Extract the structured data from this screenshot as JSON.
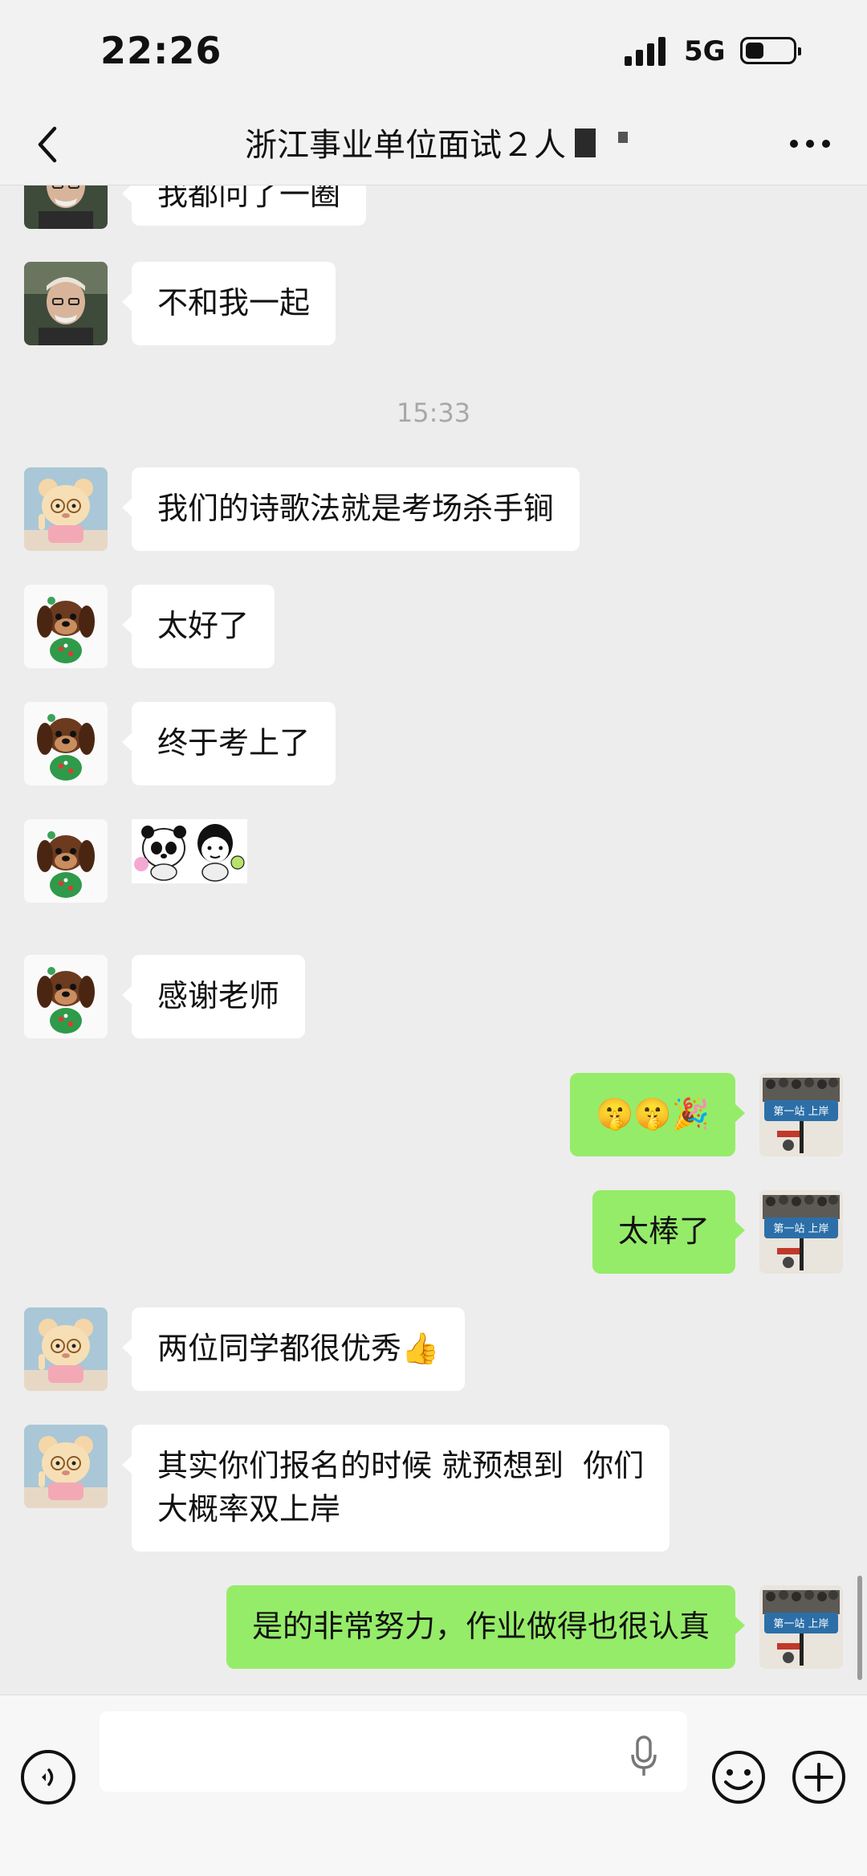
{
  "status_bar": {
    "time": "22:26",
    "network": "5G"
  },
  "header": {
    "title": "浙江事业单位面试２人"
  },
  "chat": {
    "partial_top_message": "我都问了一圈",
    "timestamp": "15:33",
    "messages": [
      {
        "text": "不和我一起"
      },
      {
        "text": "我们的诗歌法就是考场杀手锏"
      },
      {
        "text": "太好了"
      },
      {
        "text": "终于考上了"
      },
      {
        "text": "感谢老师"
      },
      {
        "text": "🤫🤫🎉"
      },
      {
        "text": "太棒了"
      },
      {
        "text": "两位同学都很优秀👍"
      },
      {
        "line1": "其实你们报名的时候 就预想到  你们",
        "line2": "大概率双上岸"
      },
      {
        "text": "是的非常努力，作业做得也很认真"
      }
    ],
    "avatar_labels": {
      "sender_sign": "第一站 上岸"
    }
  },
  "colors": {
    "background": "#ededed",
    "self_bubble": "#95ec69",
    "other_bubble": "#ffffff"
  },
  "icons": {
    "back": "chevron-left-icon",
    "more": "more-dots-icon",
    "voice": "voice-icon",
    "mic": "mic-icon",
    "emoji": "emoji-icon",
    "plus": "plus-icon"
  }
}
